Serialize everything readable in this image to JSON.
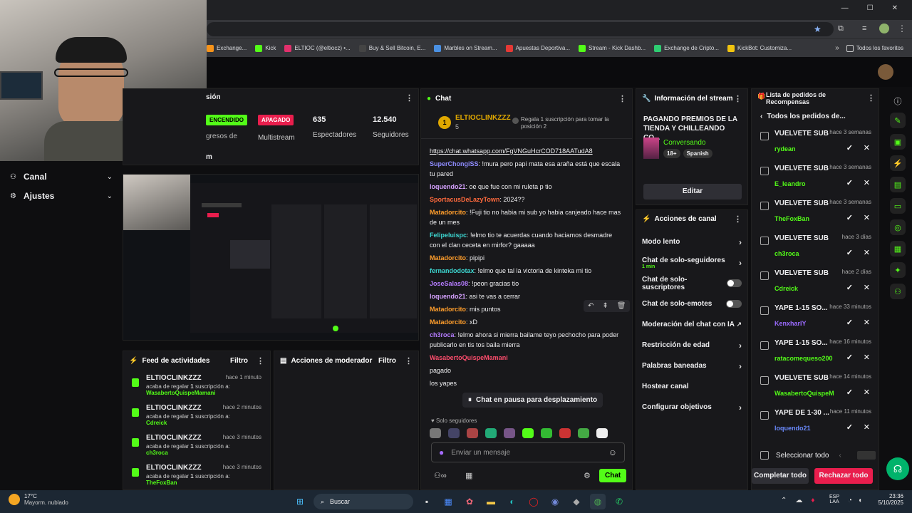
{
  "browser": {
    "window_controls": [
      "—",
      "☐",
      "✕"
    ],
    "bookmarks": [
      {
        "label": "Exchange...",
        "color": "#f7931a"
      },
      {
        "label": "Kick",
        "color": "#53fc18"
      },
      {
        "label": "ELTIOC (@eltiocz) •...",
        "color": "#e1306c"
      },
      {
        "label": "Buy & Sell Bitcoin, E...",
        "color": "#444"
      },
      {
        "label": "Marbles on Stream...",
        "color": "#4a90e2"
      },
      {
        "label": "Apuestas Deportiva...",
        "color": "#e53935"
      },
      {
        "label": "Stream - Kick Dashb...",
        "color": "#53fc18"
      },
      {
        "label": "Exchange de Cripto...",
        "color": "#2ecc71"
      },
      {
        "label": "KickBot: Customiza...",
        "color": "#f1c40f"
      }
    ],
    "favorites_label": "Todos los favoritos"
  },
  "left": {
    "section_title": "sión",
    "status_on": "ENCENDIDO",
    "status_off": "APAGADO",
    "multistream": "Multistream",
    "ingresos": "gresos de",
    "viewers_value": "635",
    "viewers_label": "Espectadores",
    "followers_value": "12.540",
    "followers_label": "Seguidores",
    "menu_canal": "Canal",
    "menu_ajustes": "Ajustes",
    "letter_m": "m"
  },
  "feed": {
    "title": "Feed de actividades",
    "filter": "Filtro",
    "items": [
      {
        "user": "ELTIOCLINKZZZ",
        "time": "hace 1 minuto",
        "text": "acaba de regalar",
        "count": "1",
        "suffix": "suscripción a:",
        "target": "WasabertoQuispeMamani"
      },
      {
        "user": "ELTIOCLINKZZZ",
        "time": "hace 2 minutos",
        "text": "acaba de regalar",
        "count": "1",
        "suffix": "suscripción a:",
        "target": "Cdreick"
      },
      {
        "user": "ELTIOCLINKZZZ",
        "time": "hace 3 minutos",
        "text": "acaba de regalar",
        "count": "1",
        "suffix": "suscripción a:",
        "target": "ch3roca"
      },
      {
        "user": "ELTIOCLINKZZZ",
        "time": "hace 3 minutos",
        "text": "acaba de regalar",
        "count": "1",
        "suffix": "suscripción a:",
        "target": "TheFoxBan"
      }
    ]
  },
  "mod": {
    "title": "Acciones de moderador",
    "filter": "Filtro"
  },
  "chat": {
    "title": "Chat",
    "pinned_user": "ELTIOCLINKZZZ",
    "pinned_count": "5",
    "pinned_badge": "1",
    "pinned_msg": "Regala 1 suscripción para tomar la posición 2",
    "messages": [
      {
        "user": "",
        "color": "#8ab4f8",
        "text": "https://chat.whatsapp.com/FgVNGuHcrCOD718AATudA8"
      },
      {
        "user": "SuperChongiSS",
        "color": "#8f8cff",
        "text": "!mura pero papi mata esa araña está que escala tu pared"
      },
      {
        "user": "loquendo21",
        "color": "#d6a2ff",
        "text": "oe que fue con mi ruleta p tio"
      },
      {
        "user": "SportacusDeLazyTown",
        "color": "#ff6a3d",
        "text": "2024??"
      },
      {
        "user": "Matadorcito",
        "color": "#ff9e2c",
        "text": "!Fuji tio no habia mi sub yo habia canjeado hace mas de un mes"
      },
      {
        "user": "Felipeluispc",
        "color": "#3dd6d0",
        "text": "!elmo tio te acuerdas cuando haciamos desmadre con el clan ceceta en mirfor? gaaaaa"
      },
      {
        "user": "Matadorcito",
        "color": "#ff9e2c",
        "text": "pipipi"
      },
      {
        "user": "fernandodotax",
        "color": "#3dd6d0",
        "text": "!elmo que tal la victoria de kinteka mi tio"
      },
      {
        "user": "JoseSalas08",
        "color": "#b57cff",
        "text": "!peon gracias tio"
      },
      {
        "user": "loquendo21",
        "color": "#d6a2ff",
        "text": "asi te vas a cerrar"
      },
      {
        "user": "Matadorcito",
        "color": "#ff9e2c",
        "text": "mis puntos"
      },
      {
        "user": "Matadorcito",
        "color": "#ff9e2c",
        "text": "xD"
      },
      {
        "user": "ch3roca",
        "color": "#b57cff",
        "text": "!elmo ahora si mierra bailame teyo pechocho para poder publicarlo en tis tos baila mierra"
      },
      {
        "user": "WasabertoQuispeMamani",
        "color": "#ff4d6d",
        "text": ""
      },
      {
        "user": "",
        "color": "#efeff1",
        "text": "pagado"
      },
      {
        "user": "",
        "color": "#efeff1",
        "text": "los yapes"
      }
    ],
    "paused": "Chat en pausa para desplazamiento",
    "followers_only": "Solo seguidores",
    "input_placeholder": "Enviar un mensaje",
    "send": "Chat"
  },
  "stream_info": {
    "title": "Información del stream",
    "stream_title": "PAGANDO PREMIOS DE LA TIENDA Y CHILLEANDO CO...",
    "category": "Conversando",
    "tag1": "18+",
    "tag2": "Spanish",
    "edit": "Editar"
  },
  "channel_actions": {
    "title": "Acciones de canal",
    "items": [
      {
        "label": "Modo lento",
        "sub": "",
        "control": "chevron"
      },
      {
        "label": "Chat de solo-seguidores",
        "sub": "1 min",
        "control": "chevron"
      },
      {
        "label": "Chat de solo-suscriptores",
        "sub": "",
        "control": "toggle"
      },
      {
        "label": "Chat de solo-emotes",
        "sub": "",
        "control": "toggle"
      },
      {
        "label": "Moderación del chat con IA",
        "sub": "",
        "control": "external"
      },
      {
        "label": "Restricción de edad",
        "sub": "",
        "control": "chevron"
      },
      {
        "label": "Palabras baneadas",
        "sub": "",
        "control": "chevron"
      },
      {
        "label": "Hostear canal",
        "sub": "",
        "control": "none"
      },
      {
        "label": "Configurar objetivos",
        "sub": "",
        "control": "chevron"
      }
    ]
  },
  "rewards": {
    "title": "Lista de pedidos de Recompensas",
    "back": "Todos los pedidos de...",
    "items": [
      {
        "title": "VUELVETE SUB",
        "time": "hace 3 semanas",
        "user": "rydean"
      },
      {
        "title": "VUELVETE SUB",
        "time": "hace 3 semanas",
        "user": "E_leandro"
      },
      {
        "title": "VUELVETE SUB",
        "time": "hace 3 semanas",
        "user": "TheFoxBan"
      },
      {
        "title": "VUELVETE SUB",
        "time": "hace 3 días",
        "user": "ch3roca"
      },
      {
        "title": "VUELVETE SUB",
        "time": "hace 2 días",
        "user": "Cdreick"
      },
      {
        "title": "YAPE 1-15 SO...",
        "time": "hace 33 minutos",
        "user": "KenxharIY"
      },
      {
        "title": "YAPE 1-15 SO...",
        "time": "hace 16 minutos",
        "user": "ratacomequeso200"
      },
      {
        "title": "VUELVETE SUB",
        "time": "hace 14 minutos",
        "user": "WasabertoQuispeM"
      },
      {
        "title": "YAPE DE 1-30 ...",
        "time": "hace 11 minutos",
        "user": "loquendo21"
      }
    ],
    "select_all": "Seleccionar todo",
    "complete_all": "Completar todo",
    "reject_all": "Rechazar todo"
  },
  "taskbar": {
    "temp": "17°C",
    "weather": "Mayorm. nublado",
    "search": "Buscar",
    "lang1": "ESP",
    "lang2": "LAA",
    "time": "23:36",
    "date": "5/10/2025"
  }
}
